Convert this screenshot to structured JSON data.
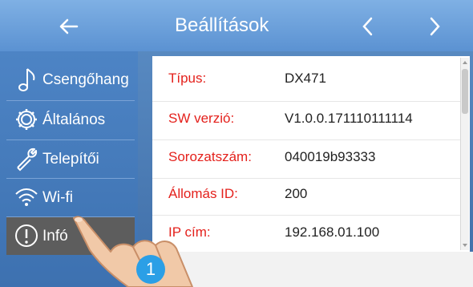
{
  "header": {
    "title": "Beállítások",
    "back_icon": "arrow-left-icon",
    "prev_icon": "chevron-left-icon",
    "next_icon": "chevron-right-icon"
  },
  "sidebar": {
    "items": [
      {
        "label": "Csengőhang",
        "icon": "music-note-icon"
      },
      {
        "label": "Általános",
        "icon": "gear-icon"
      },
      {
        "label": "Telepítői",
        "icon": "wrench-icon"
      },
      {
        "label": "Wi-fi",
        "icon": "wifi-icon"
      },
      {
        "label": "Infó",
        "icon": "info-icon",
        "active": true
      }
    ]
  },
  "info": {
    "rows": [
      {
        "key": "Típus:",
        "value": "DX471"
      },
      {
        "key": "SW verzió:",
        "value": "V1.0.0.171110111114"
      },
      {
        "key": "Sorozatszám:",
        "value": "040019b93333"
      },
      {
        "key": "Állomás ID:",
        "value": "200"
      },
      {
        "key": "IP cím:",
        "value": "192.168.01.100"
      }
    ]
  },
  "annotation": {
    "step": "1"
  },
  "colors": {
    "header_top": "#7fb0e4",
    "sidebar": "#4d84c5",
    "active_item": "#5d5d5d",
    "key_text": "#e4211c",
    "badge": "#2b9fe6"
  }
}
